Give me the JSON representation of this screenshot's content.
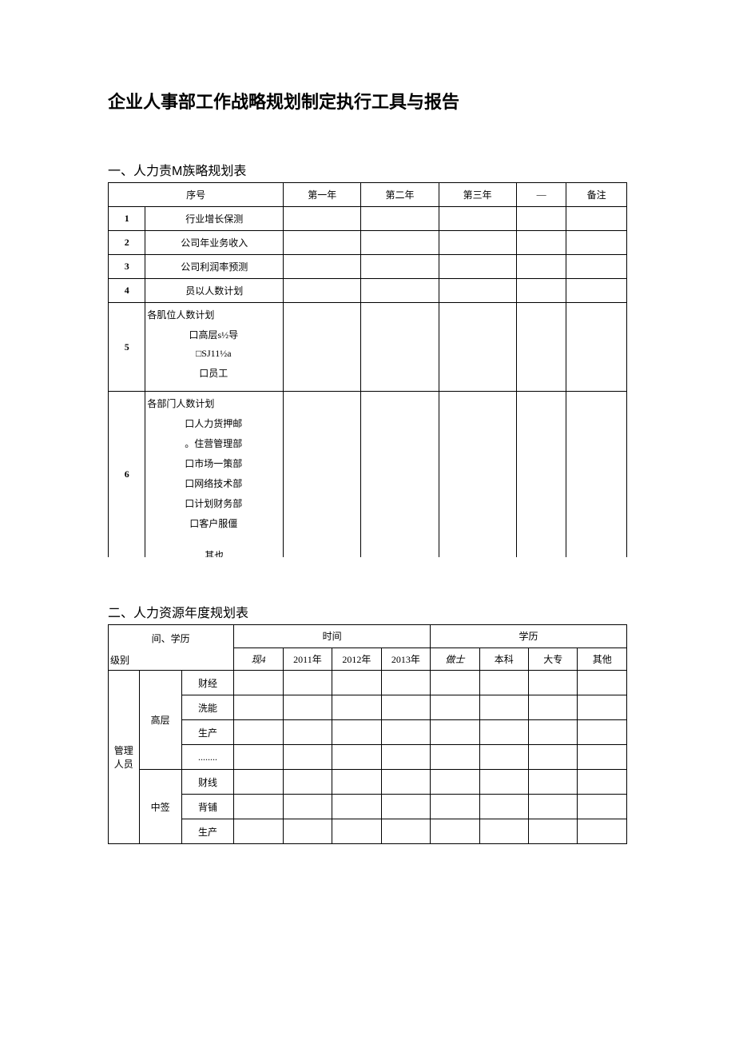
{
  "title": "企业人事部工作战略规划制定执行工具与报告",
  "section1": {
    "heading": "一、人力责M族略规划表",
    "headers": {
      "seq": "序号",
      "y1": "第一年",
      "y2": "第二年",
      "y3": "第三年",
      "dash": "—",
      "note": "备注"
    },
    "rows": [
      {
        "num": "1",
        "label": "行业增长保测"
      },
      {
        "num": "2",
        "label": "公司年业务收入"
      },
      {
        "num": "3",
        "label": "公司利润率预测"
      },
      {
        "num": "4",
        "label": "员以人数计划"
      }
    ],
    "row5": {
      "num": "5",
      "top": "各肌位人数计划",
      "lines": [
        "口高层s½导",
        "□SJ11½a",
        "口员工"
      ]
    },
    "row6": {
      "num": "6",
      "top": "各部门人数计划",
      "lines": [
        "口人力货押邮",
        "。住营管理部",
        "口市场一策部",
        "口网络技术部",
        "口计划财务部",
        "口客户服僵"
      ],
      "cut": "其也"
    }
  },
  "section2": {
    "heading": "二、人力资源年度规划表",
    "headers": {
      "corner_top": "间、学历",
      "corner_bottom": "级别",
      "time": "时间",
      "edu": "学历",
      "time_cols": [
        "现4",
        "2011年",
        "2012年",
        "2013年"
      ],
      "edu_cols": [
        "做士",
        "本科",
        "大专",
        "其他"
      ]
    },
    "body": {
      "group": "管理人员",
      "levels": [
        {
          "name": "高层",
          "cats": [
            "财经",
            "洗能",
            "生产",
            "........"
          ]
        },
        {
          "name": "中签",
          "cats": [
            "财线",
            "背铺",
            "生产"
          ]
        }
      ]
    }
  }
}
